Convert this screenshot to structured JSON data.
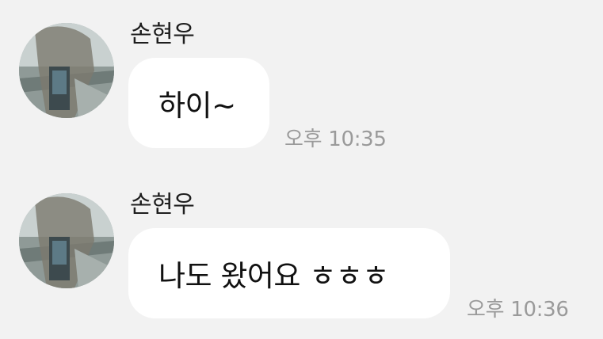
{
  "messages": [
    {
      "sender": "손현우",
      "text": "하이~",
      "time": "오후 10:35",
      "avatar_icon": "profile-photo-avatar"
    },
    {
      "sender": "손현우",
      "text": "나도 왔어요 ㅎㅎㅎ",
      "time": "오후 10:36",
      "avatar_icon": "profile-photo-avatar"
    }
  ],
  "colors": {
    "background": "#f2f2f2",
    "bubble": "#ffffff",
    "timestamp": "#9a9a9a"
  }
}
